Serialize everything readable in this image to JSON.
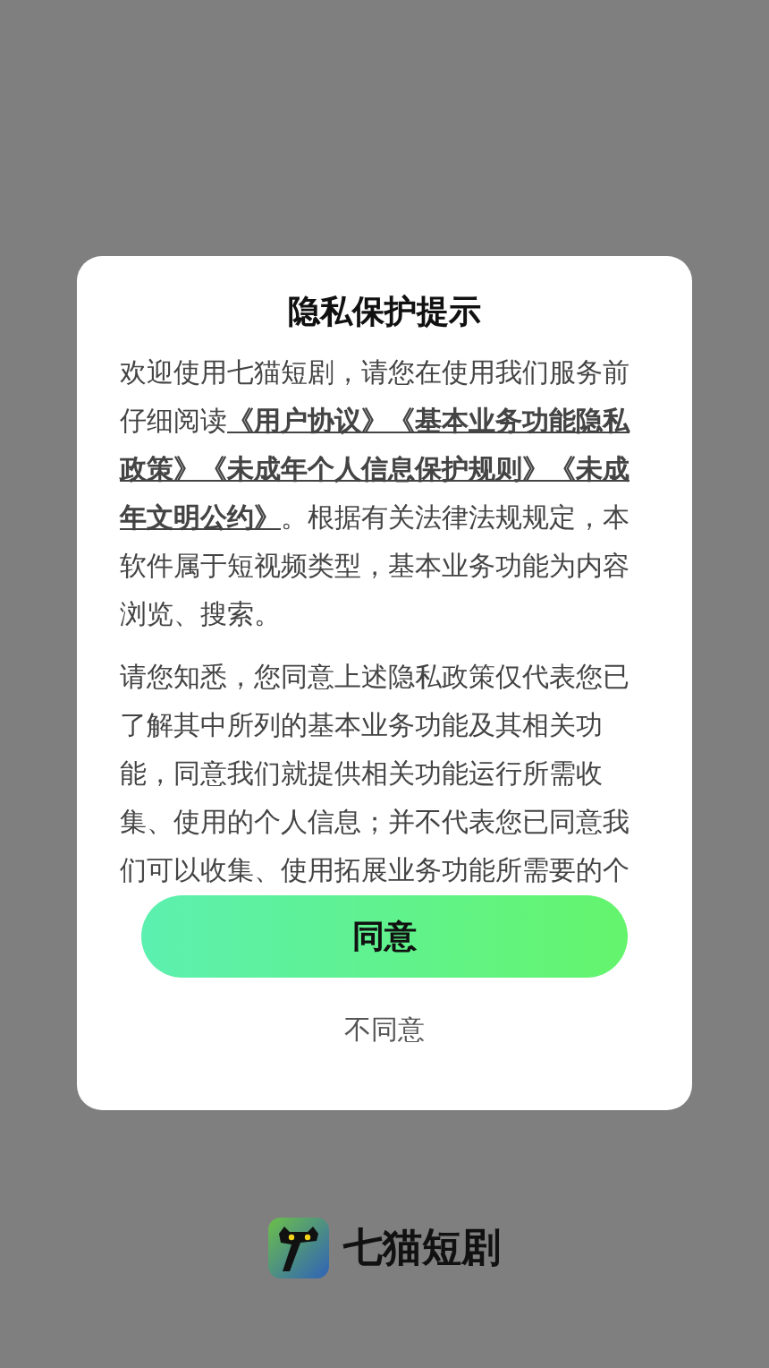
{
  "dialog": {
    "title": "隐私保护提示",
    "intro": [
      {
        "kind": "text",
        "text": "欢迎使用七猫短剧，请您在使用我们服务前仔细阅读"
      },
      {
        "kind": "link",
        "text": "《用户协议》"
      },
      {
        "kind": "link",
        "text": "《基本业务功能隐私政策》"
      },
      {
        "kind": "link",
        "text": "《未成年个人信息保护规则》"
      },
      {
        "kind": "link",
        "text": "《未成年文明公约》"
      },
      {
        "kind": "text",
        "text": "。根据有关法律法规规定，本软件属于短视频类型，基本业务功能为内容浏览、搜索。"
      }
    ],
    "notice": "请您知悉，您同意上述隐私政策仅代表您已了解其中所列的基本业务功能及其相关功能，同意我们就提供相关功能运行所需收集、使用的个人信息；并不代表您已同意我们可以收集、使用拓展业务功能所需要的个",
    "agree_button": "同意",
    "decline_button": "不同意"
  },
  "brand": {
    "name": "七猫短剧"
  }
}
